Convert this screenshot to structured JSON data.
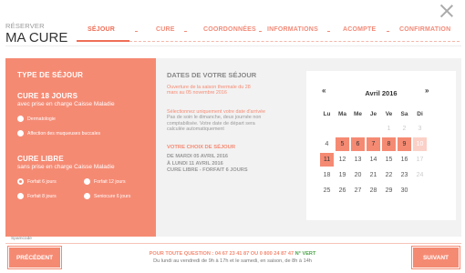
{
  "header": {
    "small": "RÉSERVER",
    "big": "MA CURE"
  },
  "steps": [
    "SÉJOUR",
    "CURE",
    "COORDONNÉES",
    "INFORMATIONS",
    "ACOMPTE",
    "CONFIRMATION"
  ],
  "left": {
    "title": "TYPE DE SÉJOUR",
    "cure18": "CURE 18 JOURS",
    "cure18_sub": "avec prise en charge Caisse Maladie",
    "opt_derm": "Dermatologie",
    "opt_muq": "Affection des muqueuses buccales",
    "libre": "CURE LIBRE",
    "libre_sub": "sans prise en charge Caisse Maladie",
    "f6": "Forfait 6 jours",
    "f12": "Forfait 12 jours",
    "f8": "Forfait 8 jours",
    "sen6": "Seniocure 6 jours"
  },
  "mid": {
    "title": "DATES DE VOTRE SÉJOUR",
    "ouverture": "Ouverture de la saison thermale du 28 mars au 05 novembre 2016",
    "select1": "Sélectionnez uniquement votre date d'arrivée",
    "select2": "Pas de soin le dimanche, deux journée non comptabilisée. Votre date de départ sera calculée automatiquement",
    "choix": "VOTRE CHOIX DE SÉJOUR",
    "du": "DE MARDI 05 AVRIL 2016",
    "au": "À LUNDI 11 AVRIL 2016",
    "type": "CURE LIBRE - FORFAIT 6 JOURS"
  },
  "cal": {
    "prev": "«",
    "next": "»",
    "month": "Avril 2016",
    "days": [
      "Lu",
      "Ma",
      "Me",
      "Je",
      "Ve",
      "Sa",
      "Di"
    ],
    "weeks": [
      [
        "",
        "",
        "",
        "",
        "1",
        "2",
        "3"
      ],
      [
        "4",
        "5",
        "6",
        "7",
        "8",
        "9",
        "10"
      ],
      [
        "11",
        "12",
        "13",
        "14",
        "15",
        "16",
        "17"
      ],
      [
        "18",
        "19",
        "20",
        "21",
        "22",
        "23",
        "24"
      ],
      [
        "25",
        "26",
        "27",
        "28",
        "29",
        "30",
        ""
      ]
    ]
  },
  "spamcode": "Spamcode",
  "footer": {
    "prev": "PRÉCÉDENT",
    "next": "SUIVANT",
    "q": "POUR TOUTE QUESTION : 04 67 23 41 87 OU 0 800 24 87 47",
    "vert": "N° VERT",
    "hours": "Du lundi au vendredi de 9h à 17h et le samedi, en saison, de 8h à 14h"
  }
}
